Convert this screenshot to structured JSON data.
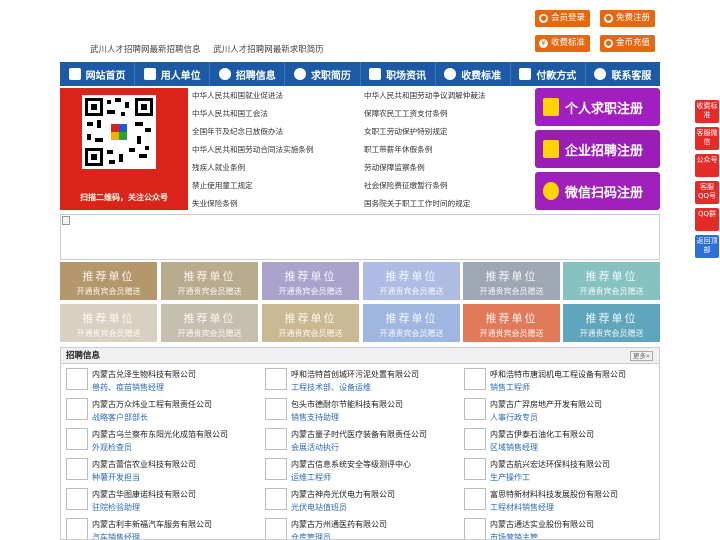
{
  "top_buttons": {
    "member_login": "会员登录",
    "free_register": "免费注册",
    "fee_standard": "收费标准",
    "gold_recharge": "金币充值"
  },
  "header_links": [
    "武川人才招聘网最新招聘信息",
    "武川人才招聘网最新求职简历"
  ],
  "nav": [
    "网站首页",
    "用人单位",
    "招聘信息",
    "求职简历",
    "职场资讯",
    "收费标准",
    "付款方式",
    "联系客服"
  ],
  "qr_caption": "扫描二维码，关注公众号",
  "laws_left": [
    "中华人民共和国就业促进法",
    "中华人民共和国工会法",
    "全国年节及纪念日放假办法",
    "中华人民共和国劳动合同法实施条例",
    "残疾人就业条例",
    "禁止使用童工规定",
    "失业保险条例"
  ],
  "laws_right": [
    "中华人民共和国劳动争议调解仲裁法",
    "保障农民工工资支付条例",
    "女职工劳动保护特别规定",
    "职工带薪年休假条例",
    "劳动保障监察条例",
    "社会保险费征缴暂行条例",
    "国务院关于职工工作时间的规定"
  ],
  "register": {
    "personal": "个人求职注册",
    "company": "企业招聘注册",
    "wechat": "微信扫码注册"
  },
  "recommend": {
    "title": "推荐单位",
    "sub": "开通贵宾会员赠送",
    "colors": [
      "#b5976c",
      "#b9ab8e",
      "#aaa4cc",
      "#aebce4",
      "#9fa8b2",
      "#86c2c0",
      "#d8d0c0",
      "#c5bfb0",
      "#c9b890",
      "#9fb6e0",
      "#e07a5a",
      "#5fa6bd"
    ]
  },
  "recruit": {
    "title": "招聘信息",
    "more": "更多»",
    "jobs": [
      {
        "company": "内蒙古兑泽生物科技有限公司",
        "position": "兽药、疫苗销售经理"
      },
      {
        "company": "呼和浩特首创城环污泥处置有限公司",
        "position": "工程技术部、设备运维"
      },
      {
        "company": "呼和浩特市唐润机电工程设备有限公司",
        "position": "销售工程师"
      },
      {
        "company": "内蒙古万众炜业工程有限责任公司",
        "position": "战略客户部部长"
      },
      {
        "company": "包头市德耐尔节能科技有限公司",
        "position": "销售支持助理"
      },
      {
        "company": "内蒙古广羿房地产开发有限公司",
        "position": "人事行政专员"
      },
      {
        "company": "内蒙古乌兰察布东阳光化成箔有限公司",
        "position": "外观检查员"
      },
      {
        "company": "内蒙古量子时代医疗装备有限责任公司",
        "position": "会展活动执行"
      },
      {
        "company": "内蒙古伊泰石油化工有限公司",
        "position": "区域销售经理"
      },
      {
        "company": "内蒙古蕾信农业科技有限公司",
        "position": "种薯开发担当"
      },
      {
        "company": "内蒙古信息系统安全等级测评中心",
        "position": "运维工程师"
      },
      {
        "company": "内蒙古航兴宏达环保科技有限公司",
        "position": "生产操作工"
      },
      {
        "company": "内蒙古华图康诺科技有限公司",
        "position": "驻院检验助理"
      },
      {
        "company": "内蒙古神舟光伏电力有限公司",
        "position": "光伏电站值班员"
      },
      {
        "company": "富思特新材料科技发展股份有限公司",
        "position": "工程材料销售经理"
      },
      {
        "company": "内蒙古利丰新福汽车服务有限公司",
        "position": "汽车销售经理"
      },
      {
        "company": "内蒙古万州通医药有限公司",
        "position": "仓库管理员"
      },
      {
        "company": "内蒙古通达实业股份有限公司",
        "position": "市场营销主管"
      }
    ]
  },
  "side": [
    "收费标准",
    "客服微信",
    "公众号",
    "客服QQ号",
    "QQ群",
    "返回顶部"
  ]
}
